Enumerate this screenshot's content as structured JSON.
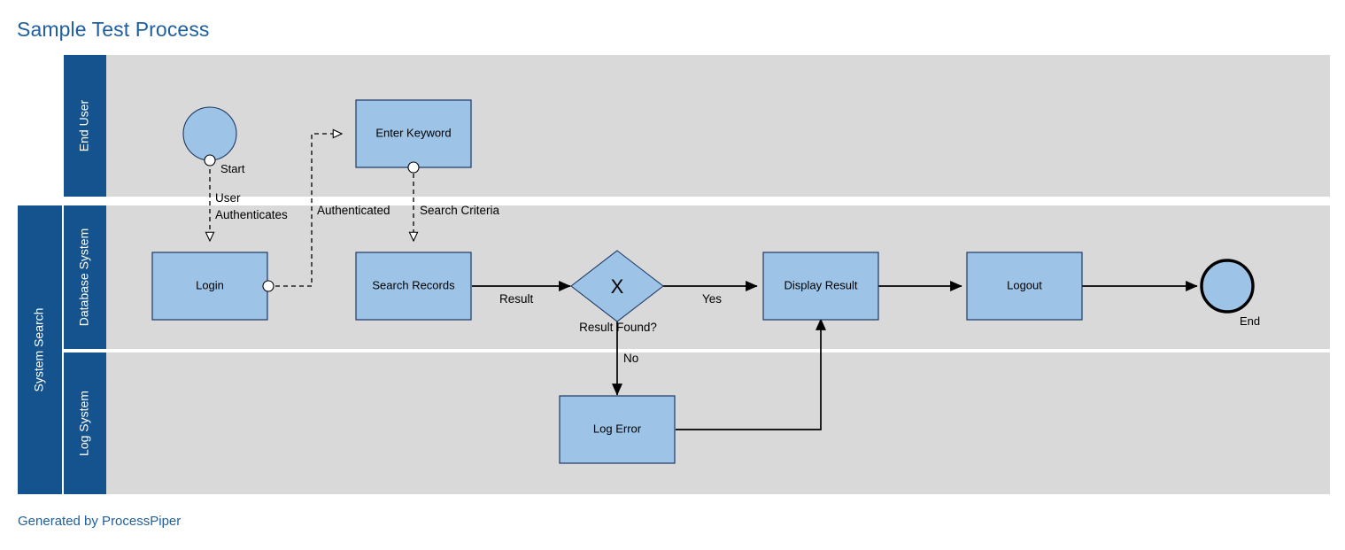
{
  "header": {
    "title": "Sample Test Process"
  },
  "footer": {
    "note": "Generated by ProcessPiper"
  },
  "colors": {
    "title_text": "#1F5FA0",
    "lane_header_fill": "#15538F",
    "lane_body_fill": "#D9D9D9",
    "node_fill": "#9DC3E6",
    "node_stroke": "#1F3864",
    "connector": "#000000",
    "page_background": "#FFFFFF"
  },
  "pools": [
    {
      "name": "",
      "lanes": [
        {
          "label": "End User"
        }
      ]
    },
    {
      "name": "System Search",
      "lanes": [
        {
          "label": "Database System"
        },
        {
          "label": "Log System"
        }
      ]
    }
  ],
  "nodes": [
    {
      "id": "start",
      "type": "start-event",
      "label": "Start",
      "lane": "End User"
    },
    {
      "id": "enter-keyword",
      "type": "task",
      "label": "Enter Keyword",
      "lane": "End User"
    },
    {
      "id": "login",
      "type": "task",
      "label": "Login",
      "lane": "Database System"
    },
    {
      "id": "search-records",
      "type": "task",
      "label": "Search Records",
      "lane": "Database System"
    },
    {
      "id": "result-found",
      "type": "exclusive-gateway",
      "label": "Result Found?",
      "marker": "X",
      "lane": "Database System"
    },
    {
      "id": "display-result",
      "type": "task",
      "label": "Display Result",
      "lane": "Database System"
    },
    {
      "id": "logout",
      "type": "task",
      "label": "Logout",
      "lane": "Database System"
    },
    {
      "id": "end",
      "type": "end-event",
      "label": "End",
      "lane": "Database System"
    },
    {
      "id": "log-error",
      "type": "task",
      "label": "Log Error",
      "lane": "Log System"
    }
  ],
  "connectors": [
    {
      "id": "c1",
      "from": "start",
      "to": "login",
      "kind": "message",
      "label_line1": "User",
      "label_line2": "Authenticates"
    },
    {
      "id": "c2",
      "from": "login",
      "to": "enter-keyword",
      "kind": "message",
      "label_line1": "Authenticated",
      "label_line2": ""
    },
    {
      "id": "c3",
      "from": "enter-keyword",
      "to": "search-records",
      "kind": "message",
      "label_line1": "Search Criteria",
      "label_line2": ""
    },
    {
      "id": "c4",
      "from": "search-records",
      "to": "result-found",
      "kind": "sequence",
      "label_line1": "Result",
      "label_line2": ""
    },
    {
      "id": "c5",
      "from": "result-found",
      "to": "display-result",
      "kind": "sequence",
      "label_line1": "Yes",
      "label_line2": ""
    },
    {
      "id": "c6",
      "from": "result-found",
      "to": "log-error",
      "kind": "sequence",
      "label_line1": "No",
      "label_line2": ""
    },
    {
      "id": "c7",
      "from": "log-error",
      "to": "display-result",
      "kind": "sequence",
      "label_line1": "",
      "label_line2": ""
    },
    {
      "id": "c8",
      "from": "display-result",
      "to": "logout",
      "kind": "sequence",
      "label_line1": "",
      "label_line2": ""
    },
    {
      "id": "c9",
      "from": "logout",
      "to": "end",
      "kind": "sequence",
      "label_line1": "",
      "label_line2": ""
    }
  ]
}
